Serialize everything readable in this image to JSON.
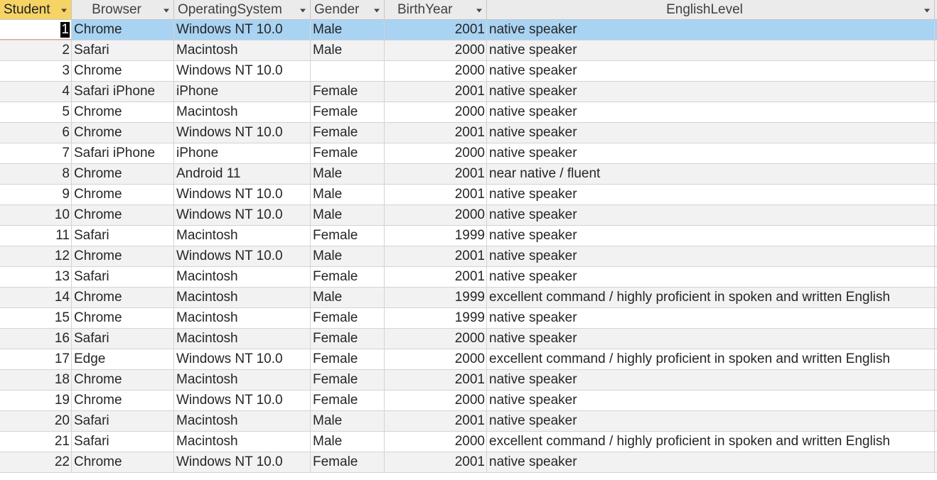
{
  "columns": [
    "Student",
    "Browser",
    "OperatingSystem",
    "Gender",
    "BirthYear",
    "EnglishLevel"
  ],
  "rows": [
    {
      "student": "1",
      "browser": "Chrome",
      "os": "Windows NT 10.0",
      "gender": "Male",
      "year": "2001",
      "level": "native speaker"
    },
    {
      "student": "2",
      "browser": "Safari",
      "os": "Macintosh",
      "gender": "Male",
      "year": "2000",
      "level": "native speaker"
    },
    {
      "student": "3",
      "browser": "Chrome",
      "os": "Windows NT 10.0",
      "gender": "",
      "year": "2000",
      "level": "native speaker"
    },
    {
      "student": "4",
      "browser": "Safari iPhone",
      "os": "iPhone",
      "gender": "Female",
      "year": "2001",
      "level": "native speaker"
    },
    {
      "student": "5",
      "browser": "Chrome",
      "os": "Macintosh",
      "gender": "Female",
      "year": "2000",
      "level": "native speaker"
    },
    {
      "student": "6",
      "browser": "Chrome",
      "os": "Windows NT 10.0",
      "gender": "Female",
      "year": "2001",
      "level": "native speaker"
    },
    {
      "student": "7",
      "browser": "Safari iPhone",
      "os": "iPhone",
      "gender": "Female",
      "year": "2000",
      "level": "native speaker"
    },
    {
      "student": "8",
      "browser": "Chrome",
      "os": "Android 11",
      "gender": "Male",
      "year": "2001",
      "level": "near native / fluent"
    },
    {
      "student": "9",
      "browser": "Chrome",
      "os": "Windows NT 10.0",
      "gender": "Male",
      "year": "2001",
      "level": "native speaker"
    },
    {
      "student": "10",
      "browser": "Chrome",
      "os": "Windows NT 10.0",
      "gender": "Male",
      "year": "2000",
      "level": "native speaker"
    },
    {
      "student": "11",
      "browser": "Safari",
      "os": "Macintosh",
      "gender": "Female",
      "year": "1999",
      "level": "native speaker"
    },
    {
      "student": "12",
      "browser": "Chrome",
      "os": "Windows NT 10.0",
      "gender": "Male",
      "year": "2001",
      "level": "native speaker"
    },
    {
      "student": "13",
      "browser": "Safari",
      "os": "Macintosh",
      "gender": "Female",
      "year": "2001",
      "level": "native speaker"
    },
    {
      "student": "14",
      "browser": "Chrome",
      "os": "Macintosh",
      "gender": "Male",
      "year": "1999",
      "level": "excellent command / highly proficient in spoken and written English"
    },
    {
      "student": "15",
      "browser": "Chrome",
      "os": "Macintosh",
      "gender": "Female",
      "year": "1999",
      "level": "native speaker"
    },
    {
      "student": "16",
      "browser": "Safari",
      "os": "Macintosh",
      "gender": "Female",
      "year": "2000",
      "level": "native speaker"
    },
    {
      "student": "17",
      "browser": "Edge",
      "os": "Windows NT 10.0",
      "gender": "Female",
      "year": "2000",
      "level": "excellent command / highly proficient in spoken and written English"
    },
    {
      "student": "18",
      "browser": "Chrome",
      "os": "Macintosh",
      "gender": "Female",
      "year": "2001",
      "level": "native speaker"
    },
    {
      "student": "19",
      "browser": "Chrome",
      "os": "Windows NT 10.0",
      "gender": "Female",
      "year": "2000",
      "level": "native speaker"
    },
    {
      "student": "20",
      "browser": "Safari",
      "os": "Macintosh",
      "gender": "Male",
      "year": "2001",
      "level": "native speaker"
    },
    {
      "student": "21",
      "browser": "Safari",
      "os": "Macintosh",
      "gender": "Male",
      "year": "2000",
      "level": "excellent command / highly proficient in spoken and written English"
    },
    {
      "student": "22",
      "browser": "Chrome",
      "os": "Windows NT 10.0",
      "gender": "Female",
      "year": "2001",
      "level": "native speaker"
    }
  ],
  "selected_row": 0,
  "icons": {
    "column_filter": "chevron-down-icon"
  },
  "colors": {
    "header_bg": "#ebebeb",
    "active_header_bg": "#f6d365",
    "selected_row_bg": "#a9d3f2",
    "alt_row_bg": "#f2f2f2"
  }
}
